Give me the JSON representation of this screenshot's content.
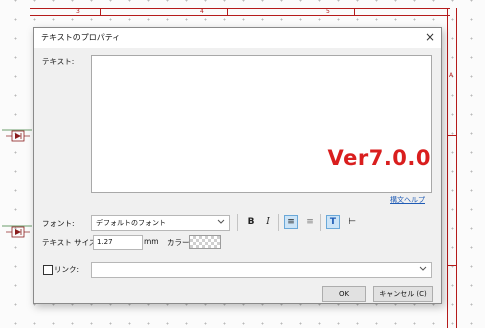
{
  "frame": {
    "col_numbers": [
      "3",
      "4",
      "5"
    ],
    "row_numbers": [
      "A"
    ]
  },
  "dialog": {
    "title": "テキストのプロパティ",
    "close_glyph": "×",
    "text_label": "テキスト:",
    "text_value": "",
    "version_overlay": "Ver7.0.0",
    "syntax_help_link": "構文ヘルプ",
    "font_label": "フォント:",
    "font_value": "デフォルトのフォント",
    "bold_label": "B",
    "italic_label": "I",
    "align_left_glyph": "≡",
    "align_right_glyph": "≡",
    "text_frame_glyph": "T",
    "width_glyph": "⊢",
    "text_size_label": "テキスト サイズ:",
    "text_size_value": "1.27",
    "unit": "mm",
    "color_label": "カラー:",
    "link_label": "リンク:",
    "link_value": "",
    "ok_label": "OK",
    "cancel_label": "キャンセル (C)"
  },
  "colors": {
    "frame": "#b51b1b",
    "version_text": "#d91e1e",
    "link": "#1f5bb5",
    "active_button": "#cce4f7"
  }
}
